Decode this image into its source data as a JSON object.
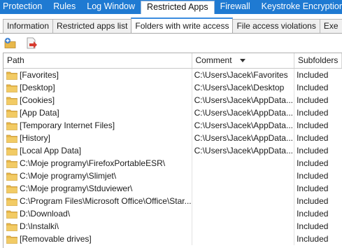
{
  "top_tabs": [
    "Protection",
    "Rules",
    "Log Window",
    "Restricted Apps",
    "Firewall",
    "Keystroke Encryption"
  ],
  "top_tabs_active": "Restricted Apps",
  "sub_tabs": [
    "Information",
    "Restricted apps list",
    "Folders with write access",
    "File access violations",
    "Exe"
  ],
  "sub_tabs_active": "Folders with write access",
  "toolbar": {
    "add_icon": "add-folder-icon",
    "remove_icon": "remove-folder-icon"
  },
  "columns": {
    "path": "Path",
    "comment": "Comment",
    "subfolders": "Subfolders"
  },
  "rows": [
    {
      "path": "[Favorites]",
      "comment": "C:\\Users\\Jacek\\Favorites",
      "sub": "Included"
    },
    {
      "path": "[Desktop]",
      "comment": "C:\\Users\\Jacek\\Desktop",
      "sub": "Included"
    },
    {
      "path": "[Cookies]",
      "comment": "C:\\Users\\Jacek\\AppData...",
      "sub": "Included"
    },
    {
      "path": "[App Data]",
      "comment": "C:\\Users\\Jacek\\AppData...",
      "sub": "Included"
    },
    {
      "path": "[Temporary Internet Files]",
      "comment": "C:\\Users\\Jacek\\AppData...",
      "sub": "Included"
    },
    {
      "path": "[History]",
      "comment": "C:\\Users\\Jacek\\AppData...",
      "sub": "Included"
    },
    {
      "path": "[Local App Data]",
      "comment": "C:\\Users\\Jacek\\AppData...",
      "sub": "Included"
    },
    {
      "path": "C:\\Moje programy\\FirefoxPortableESR\\",
      "comment": "",
      "sub": "Included"
    },
    {
      "path": "C:\\Moje programy\\Slimjet\\",
      "comment": "",
      "sub": "Included"
    },
    {
      "path": "C:\\Moje programy\\Stduviewer\\",
      "comment": "",
      "sub": "Included"
    },
    {
      "path": "C:\\Program Files\\Microsoft Office\\Office\\Star...",
      "comment": "",
      "sub": "Included"
    },
    {
      "path": "D:\\Download\\",
      "comment": "",
      "sub": "Included"
    },
    {
      "path": "D:\\Instalki\\",
      "comment": "",
      "sub": "Included"
    },
    {
      "path": "[Removable drives]",
      "comment": "",
      "sub": "Included"
    }
  ],
  "colors": {
    "accent": "#1f7ad2",
    "folder": "#e8b84a"
  }
}
